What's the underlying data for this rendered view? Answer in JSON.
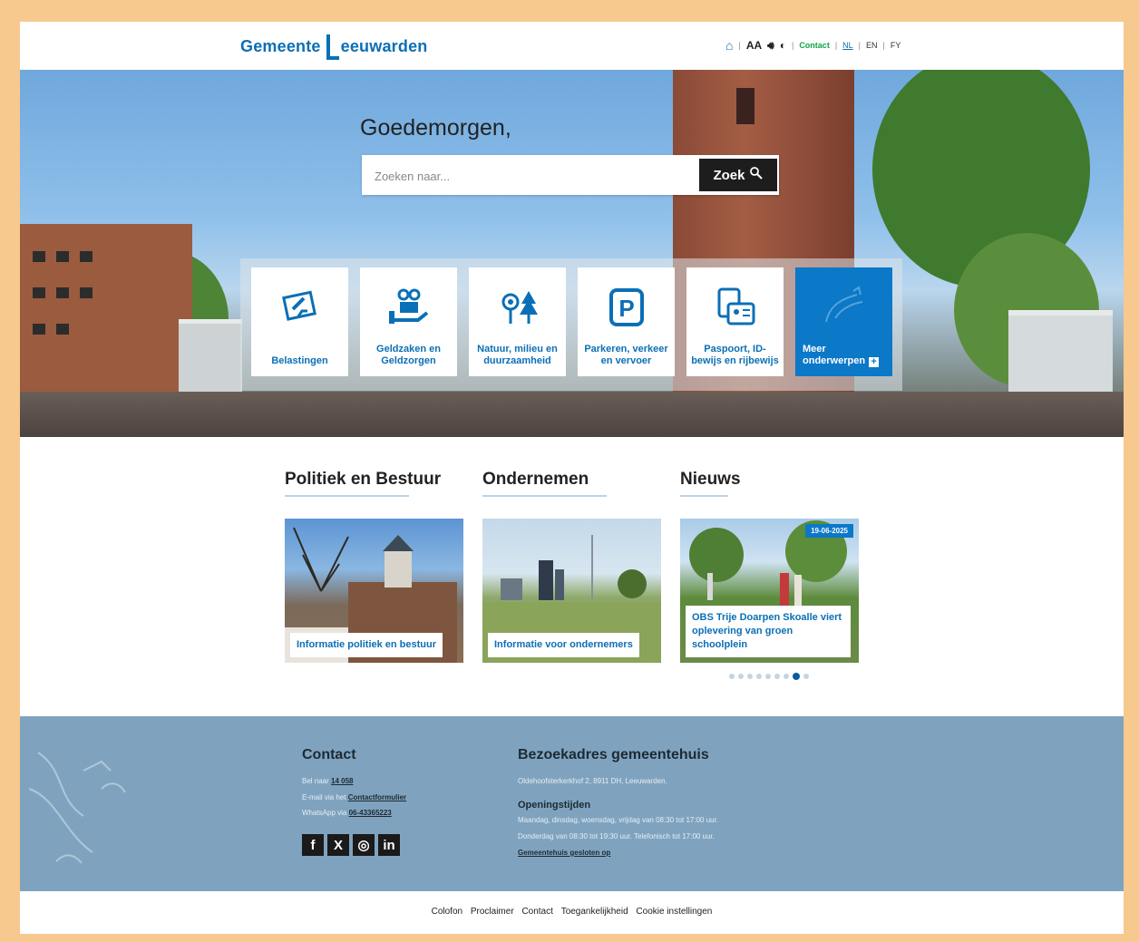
{
  "header": {
    "logo_left": "Gemeente",
    "logo_right": "eeuwarden",
    "text_size": "AA",
    "contact": "Contact",
    "lang_nl": "NL",
    "lang_en": "EN",
    "lang_fy": "FY"
  },
  "hero": {
    "greeting": "Goedemorgen,",
    "search_placeholder": "Zoeken naar...",
    "search_button": "Zoek",
    "tiles": [
      {
        "label": "Belastingen",
        "icon": "tax-card-icon"
      },
      {
        "label": "Geldzaken en Geldzorgen",
        "icon": "money-help-icon"
      },
      {
        "label": "Natuur, milieu en duurzaamheid",
        "icon": "nature-icon"
      },
      {
        "label": "Parkeren, verkeer en vervoer",
        "icon": "parking-icon"
      },
      {
        "label": "Paspoort, ID-bewijs en rijbewijs",
        "icon": "id-card-icon"
      }
    ],
    "more_label": "Meer onderwerpen"
  },
  "sections": [
    {
      "title": "Politiek en Bestuur",
      "card": "Informatie politiek en bestuur"
    },
    {
      "title": "Ondernemen",
      "card": "Informatie voor ondernemers"
    },
    {
      "title": "Nieuws",
      "card": "OBS Trije Doarpen Skoalle viert oplevering van groen schoolplein",
      "date": "19-06-2025"
    }
  ],
  "carousel": {
    "count": 9,
    "active": 8
  },
  "footer": {
    "contact_title": "Contact",
    "phone_prefix": "Bel naar",
    "phone": "14 058",
    "email_prefix": "E-mail via het",
    "email_link": "Contactformulier",
    "whatsapp_prefix": "WhatsApp via",
    "whatsapp": "06-43365223",
    "visit_title": "Bezoekadres gemeentehuis",
    "address": "Oldehoofsterkerkhof 2, 8911 DH, Leeuwarden.",
    "hours_title": "Openingstijden",
    "hours_1": "Maandag, dinsdag, woensdag, vrijdag van 08:30 tot 17:00 uur.",
    "hours_2": "Donderdag van 08:30 tot 19:30 uur. Telefonisch tot 17:00 uur.",
    "closed_link": "Gemeentehuis gesloten op",
    "social": [
      "f",
      "X",
      "◎",
      "in"
    ]
  },
  "bottom_links": [
    "Colofon",
    "Proclaimer",
    "Contact",
    "Toegankelijkheid",
    "Cookie instellingen"
  ],
  "colors": {
    "brand_blue": "#0b6fb6",
    "footer_bg": "#7fa3bf",
    "frame": "#f7c98e"
  }
}
